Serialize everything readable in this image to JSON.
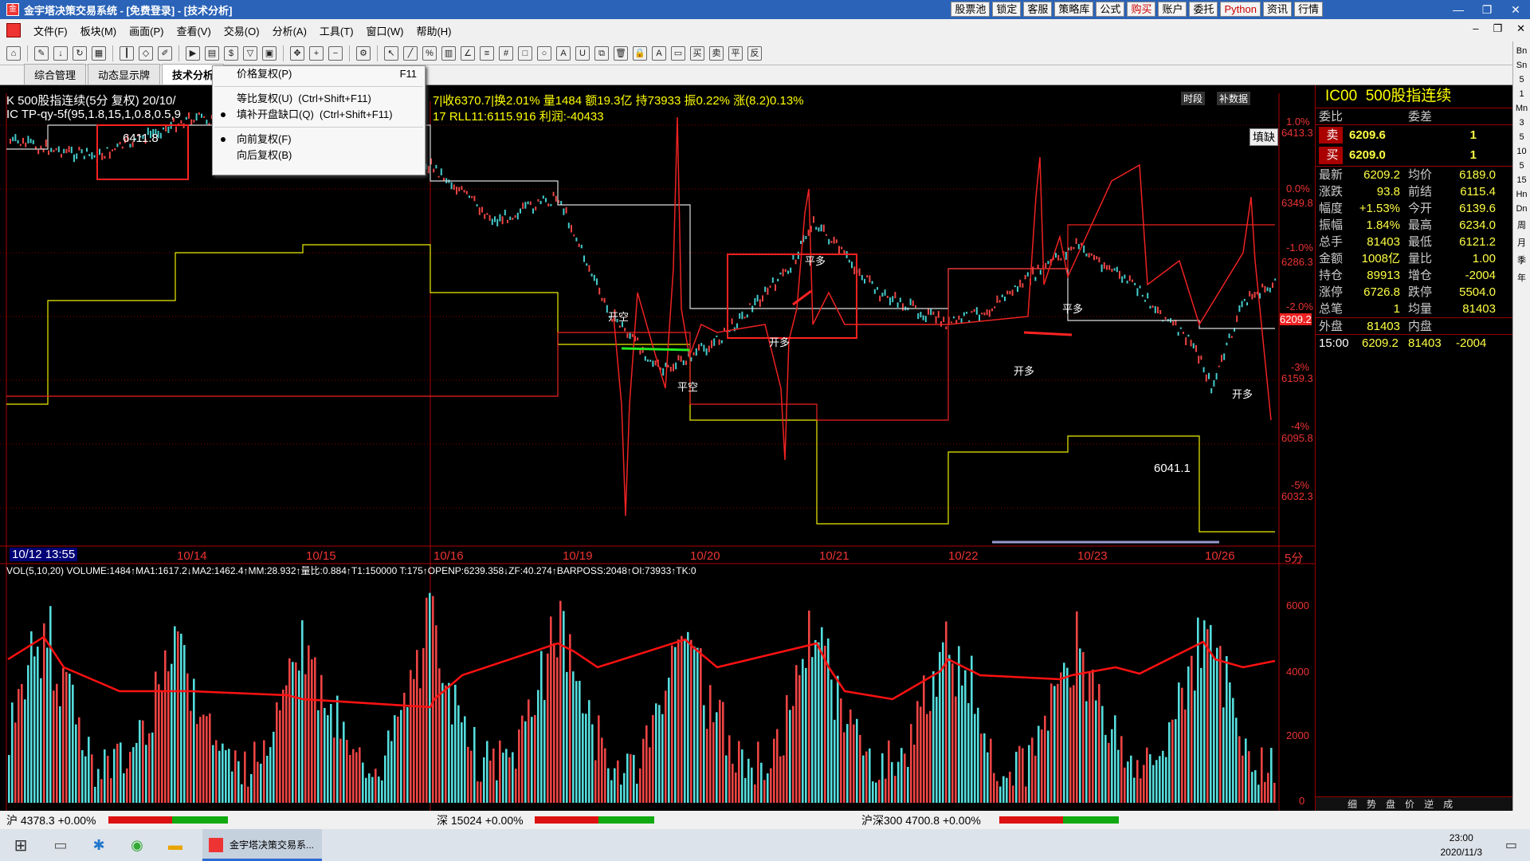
{
  "titlebar": {
    "title": "金宇塔决策交易系统 - [免费登录] - [技术分析]",
    "buttons": [
      "股票池",
      "锁定",
      "客服",
      "策略库",
      "公式",
      "购买",
      "账户",
      "委托",
      "Python",
      "资讯",
      "行情"
    ]
  },
  "menubar": {
    "items": [
      "文件(F)",
      "板块(M)",
      "画面(P)",
      "查看(V)",
      "交易(O)",
      "分析(A)",
      "工具(T)",
      "窗口(W)",
      "帮助(H)"
    ]
  },
  "tabs": [
    "综合管理",
    "动态显示牌",
    "技术分析"
  ],
  "dropdown": {
    "items": [
      {
        "label": "价格复权(P)",
        "shortcut": "F11",
        "checked": false
      },
      {
        "label": "等比复权(U)",
        "shortcut": "(Ctrl+Shift+F11)",
        "checked": false
      },
      {
        "label": "填补开盘缺口(Q)",
        "shortcut": "(Ctrl+Shift+F11)",
        "checked": true
      },
      {
        "label": "向前复权(F)",
        "shortcut": "",
        "checked": true
      },
      {
        "label": "向后复权(B)",
        "shortcut": "",
        "checked": false
      }
    ]
  },
  "chart": {
    "info1": "K  500股指连续(5分 复权) 20/10/",
    "info1b": "7|收6370.7|换2.01% 量1484 额19.3亿 持73933 振0.22% 涨(8.2)0.13%",
    "info2": "IC  TP-qy-5f(95,1.8,15,1,0.8,0.5,9",
    "info2b": "17  RLL11:6115.916  利润:-40433",
    "fill_gap_label": "填缺",
    "tabs_right": [
      "时段",
      "补数据"
    ],
    "price_labels": [
      "6413.3",
      "6349.8",
      "6286.3",
      "6209.2",
      "6159.3",
      "6095.8",
      "6032.3"
    ],
    "pct_labels": [
      "1.0%",
      "0.0%",
      "-1.0%",
      "-2.0%",
      "-3%",
      "-4%",
      "-5%"
    ],
    "hi_label": "6411.8",
    "lo_label": "6041.1",
    "date_labels": [
      "10/12 13:55",
      "10/14",
      "10/15",
      "10/16",
      "10/19",
      "10/20",
      "10/21",
      "10/22",
      "10/23",
      "10/26",
      "5分"
    ],
    "signals": [
      "开空",
      "平空",
      "开多",
      "平多",
      "开多",
      "平多",
      "开多"
    ],
    "vol_header": "VOL(5,10,20) VOLUME:1484↑MA1:1617.2↓MA2:1462.4↑MM:28.932↑量比:0.884↑T1:150000 T:175↑OPENP:6239.358↓ZF:40.274↑BARPOSS:2048↑OI:73933↑TK:0",
    "vol_labels": [
      "6000",
      "4000",
      "2000",
      "0"
    ]
  },
  "rightpanel": {
    "code": "IC00",
    "name": "500股指连续",
    "weibi": "委比",
    "weicha": "委差",
    "sell": {
      "label": "卖",
      "price": "6209.6",
      "vol": "1"
    },
    "buy": {
      "label": "买",
      "price": "6209.0",
      "vol": "1"
    },
    "rows": [
      [
        "最新",
        "6209.2",
        "均价",
        "6189.0"
      ],
      [
        "涨跌",
        "93.8",
        "前结",
        "6115.4"
      ],
      [
        "幅度",
        "+1.53%",
        "今开",
        "6139.6"
      ],
      [
        "振幅",
        "1.84%",
        "最高",
        "6234.0"
      ],
      [
        "总手",
        "81403",
        "最低",
        "6121.2"
      ],
      [
        "金额",
        "1008亿",
        "量比",
        "1.00"
      ],
      [
        "持仓",
        "89913",
        "增仓",
        "-2004"
      ],
      [
        "涨停",
        "6726.8",
        "跌停",
        "5504.0"
      ],
      [
        "总笔",
        "1",
        "均量",
        "81403"
      ]
    ],
    "waipan": [
      "外盘",
      "81403",
      "内盘",
      ""
    ],
    "tick": [
      "15:00",
      "6209.2",
      "81403",
      "-2004"
    ],
    "bottom_tabs": [
      "细",
      "势",
      "盘",
      "价",
      "逆",
      "成"
    ]
  },
  "rightbar": [
    "Bn",
    "Sn",
    "5",
    "1",
    "Mn",
    "3",
    "5",
    "10",
    "5",
    "15",
    "Hn",
    "Dn",
    "周",
    "月",
    "季",
    "年"
  ],
  "statusbar": {
    "sh": "沪 4378.3 +0.00%",
    "sz": "深 15024 +0.00%",
    "hs300": "沪深300  4700.8 +0.00%"
  },
  "taskbar": {
    "app": "金宇塔决策交易系...",
    "time": "23:00",
    "date": "2020/11/3"
  }
}
